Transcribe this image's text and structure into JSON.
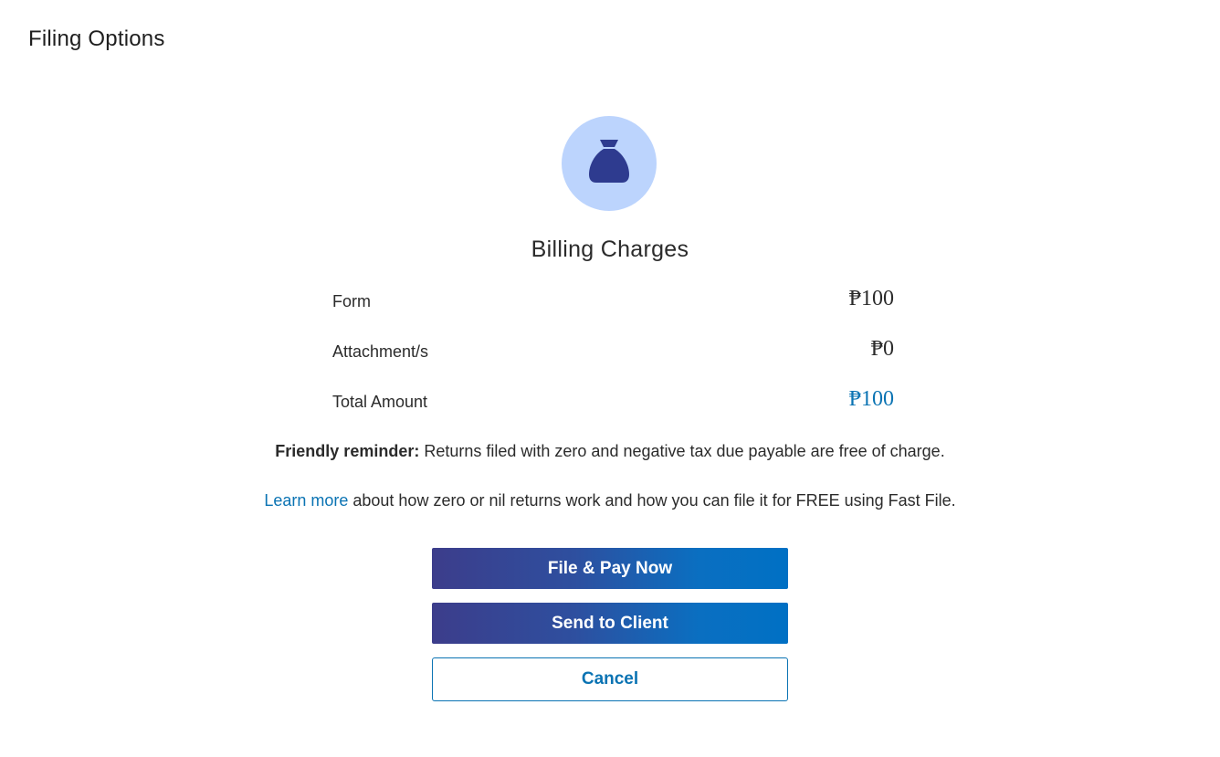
{
  "page": {
    "title": "Filing Options"
  },
  "billing": {
    "icon": "money-bag-icon",
    "title": "Billing Charges",
    "rows": [
      {
        "label": "Form",
        "value": "₱100"
      },
      {
        "label": "Attachment/s",
        "value": "₱0"
      },
      {
        "label": "Total Amount",
        "value": "₱100"
      }
    ]
  },
  "reminder": {
    "strong": "Friendly reminder:",
    "text": " Returns filed with zero and negative tax due payable are free of charge."
  },
  "learn": {
    "link": "Learn more",
    "text": " about how zero or nil returns work and how you can file it for FREE using Fast File."
  },
  "actions": {
    "file_pay": "File & Pay Now",
    "send_client": "Send to Client",
    "cancel": "Cancel"
  },
  "colors": {
    "accent": "#0a73b3",
    "icon_bg": "#bcd4fd",
    "icon_fg": "#2e3b8f",
    "button_gradient_start": "#3c3d8b",
    "button_gradient_end": "#0070c4"
  }
}
